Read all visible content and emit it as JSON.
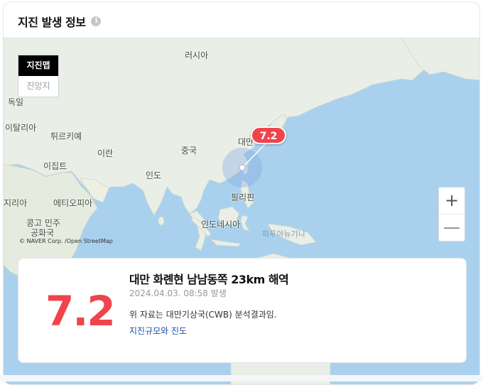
{
  "header": {
    "title": "지진 발생 정보",
    "info_icon": "i"
  },
  "toggle": {
    "selected": "지진맵",
    "other": "진앙지"
  },
  "map": {
    "labels": {
      "russia": "러시아",
      "germany": "독일",
      "italy": "이탈리아",
      "turkey": "튀르키예",
      "iran": "이란",
      "egypt": "이집트",
      "china": "중국",
      "india": "인도",
      "taiwan": "대만",
      "philippines": "필리핀",
      "indonesia": "인도네시아",
      "ethiopia": "에티오피아",
      "nigeria": "지리아",
      "drc": "콩고 민주",
      "drc2": "공화국",
      "png": "파푸아뉴기니"
    },
    "magnitude_badge": "7.2",
    "zoom_in": "+",
    "zoom_out": "—",
    "credit": "© NAVER Corp. /Open StreetMap"
  },
  "info": {
    "magnitude": "7.2",
    "location": "대만 화롄현 남남동쪽 23km 해역",
    "datetime": "2024.04.03. 08:58 발생",
    "source": "위 자료는 대만기상국(CWB) 분석결과임.",
    "link": "지진규모와 진도"
  },
  "colors": {
    "accent": "#f0444c",
    "sea": "#a9d1ee",
    "land": "#e9efe6",
    "link": "#1e50a2"
  }
}
